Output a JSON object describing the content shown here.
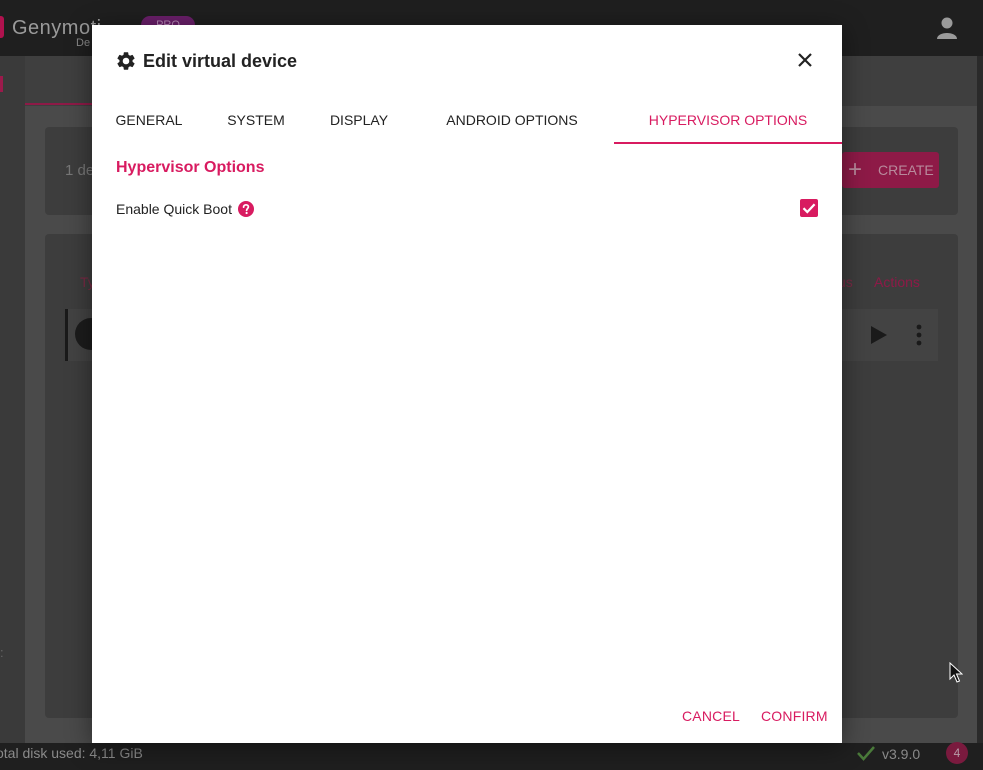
{
  "background_app": {
    "brand_name": "Genymoti",
    "brand_sub": "De",
    "plan_badge": "PRO",
    "devices_count_text": "1 de",
    "create_button": "CREATE",
    "table_headers": {
      "type_partial": "Ty",
      "status_partial": "us",
      "actions": "Actions"
    },
    "side_glyph": ":",
    "status_bar": {
      "disk_usage": "otal disk used: 4,11 GiB",
      "version": "v3.9.0",
      "notification_count": "4"
    }
  },
  "dialog": {
    "title": "Edit virtual device",
    "tabs": [
      {
        "label": "GENERAL",
        "active": false
      },
      {
        "label": "SYSTEM",
        "active": false
      },
      {
        "label": "DISPLAY",
        "active": false
      },
      {
        "label": "ANDROID OPTIONS",
        "active": false
      },
      {
        "label": "HYPERVISOR OPTIONS",
        "active": true
      }
    ],
    "section_title": "Hypervisor Options",
    "options": [
      {
        "label": "Enable Quick Boot",
        "checked": true
      }
    ],
    "cancel_label": "CANCEL",
    "confirm_label": "CONFIRM"
  },
  "colors": {
    "accent": "#d81b60",
    "overlay_bg": "#2f2f2f",
    "dialog_bg": "#ffffff"
  }
}
